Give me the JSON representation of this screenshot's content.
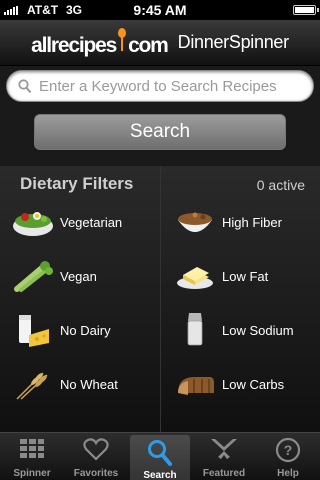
{
  "status_bar": {
    "carrier": "AT&T",
    "network": "3G",
    "time": "9:45 AM",
    "battery_level": 1.0
  },
  "header": {
    "logo_main": "allrecipes",
    "logo_dot": ".",
    "logo_tld": "com",
    "logo_app": "DinnerSpinner",
    "brand_color": "#f7941d"
  },
  "search": {
    "placeholder": "Enter a Keyword to Search Recipes",
    "value": "",
    "button_label": "Search"
  },
  "filters": {
    "title": "Dietary Filters",
    "count": "0 active",
    "items": [
      {
        "label": "Vegetarian",
        "icon": "salad-icon"
      },
      {
        "label": "High Fiber",
        "icon": "cereal-bowl-icon"
      },
      {
        "label": "Vegan",
        "icon": "celery-icon"
      },
      {
        "label": "Low Fat",
        "icon": "butter-icon"
      },
      {
        "label": "No Dairy",
        "icon": "milk-cheese-icon"
      },
      {
        "label": "Low Sodium",
        "icon": "salt-shaker-icon"
      },
      {
        "label": "No Wheat",
        "icon": "wheat-icon"
      },
      {
        "label": "Low Carbs",
        "icon": "bread-icon"
      }
    ]
  },
  "tabbar": {
    "active": "Search",
    "tabs": [
      {
        "label": "Spinner",
        "icon": "grid-icon"
      },
      {
        "label": "Favorites",
        "icon": "heart-icon"
      },
      {
        "label": "Search",
        "icon": "magnifier-icon"
      },
      {
        "label": "Featured",
        "icon": "utensils-icon"
      },
      {
        "label": "Help",
        "icon": "question-icon"
      }
    ]
  }
}
